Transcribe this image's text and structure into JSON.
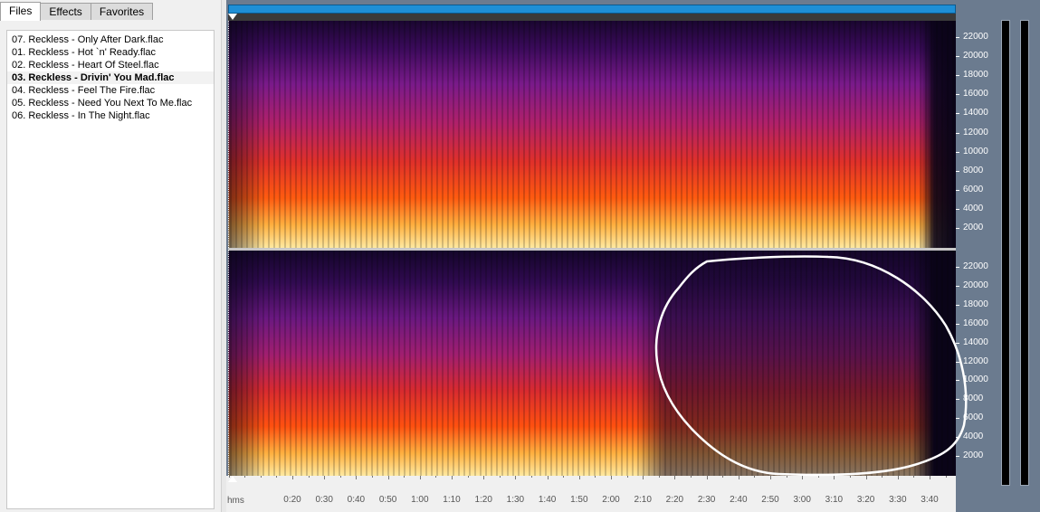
{
  "tabs": [
    {
      "label": "Files",
      "active": true
    },
    {
      "label": "Effects",
      "active": false
    },
    {
      "label": "Favorites",
      "active": false
    }
  ],
  "files": [
    {
      "name": "07. Reckless - Only After Dark.flac",
      "selected": false
    },
    {
      "name": "01. Reckless - Hot `n' Ready.flac",
      "selected": false
    },
    {
      "name": "02. Reckless - Heart Of Steel.flac",
      "selected": false
    },
    {
      "name": "03. Reckless - Drivin' You Mad.flac",
      "selected": true
    },
    {
      "name": "04. Reckless - Feel The Fire.flac",
      "selected": false
    },
    {
      "name": "05. Reckless - Need You Next To Me.flac",
      "selected": false
    },
    {
      "name": "06. Reckless - In The Night.flac",
      "selected": false
    }
  ],
  "freq_axis": {
    "unit": "Hz",
    "labels": [
      "22000",
      "20000",
      "18000",
      "16000",
      "14000",
      "12000",
      "10000",
      "8000",
      "6000",
      "4000",
      "2000"
    ]
  },
  "time_axis": {
    "unit_label": "hms",
    "labels": [
      "0:20",
      "0:30",
      "0:40",
      "0:50",
      "1:00",
      "1:10",
      "1:20",
      "1:30",
      "1:40",
      "1:50",
      "2:00",
      "2:10",
      "2:20",
      "2:30",
      "2:40",
      "2:50",
      "3:00",
      "3:10",
      "3:20",
      "3:30",
      "3:40"
    ]
  },
  "colors": {
    "timeline_bar": "#1e8fd6",
    "panel_bg": "#6b7b8f",
    "annotation_stroke": "#ffffff"
  }
}
